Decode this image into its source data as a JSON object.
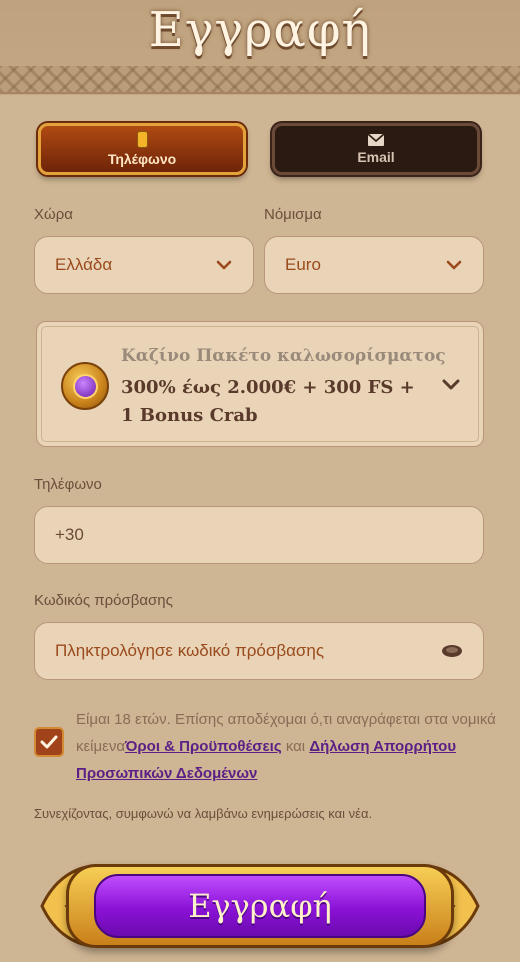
{
  "header": {
    "title": "Εγγραφή"
  },
  "tabs": [
    {
      "label": "Τηλέφωνο",
      "icon": "phone-icon",
      "active": true
    },
    {
      "label": "Email",
      "icon": "mail-icon",
      "active": false
    }
  ],
  "country": {
    "label": "Χώρα",
    "value": "Ελλάδα"
  },
  "currency": {
    "label": "Νόμισμα",
    "value": "Euro"
  },
  "bonus": {
    "subtitle": "Καζίνο Πακέτο καλωσορίσματος",
    "title": "300% έως 2.000€ + 300 FS + 1 Bonus Crab",
    "icon": "casino-coin-icon"
  },
  "phone": {
    "label": "Τηλέφωνο",
    "value": "+30"
  },
  "password": {
    "label": "Κωδικός πρόσβασης",
    "placeholder": "Πληκτρολόγησε κωδικό πρόσβασης"
  },
  "consent": {
    "checked": true,
    "text_before": "Είμαι 18 ετών. Επίσης αποδέχομαι ό,τι αναγράφεται στα νομικά κείμενα",
    "terms_link": "Όροι & Προϋποθέσεις",
    "and": "και",
    "privacy_link": "Δήλωση Απορρήτου Προσωπικών Δεδομένων"
  },
  "note": "Συνεχίζοντας, συμφωνώ να λαμβάνω ενημερώσεις και νέα.",
  "submit": {
    "label": "Εγγραφή"
  },
  "colors": {
    "accent_purple": "#8a12d6",
    "gold": "#f4b42a",
    "background": "#ceb593"
  }
}
